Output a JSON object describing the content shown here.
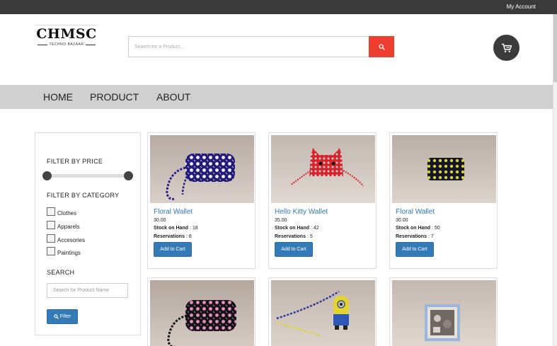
{
  "topbar": {
    "account_label": "My Account"
  },
  "header": {
    "logo_name": "CHMSC",
    "logo_tagline": "TECHNO BAZAAR",
    "search_placeholder": "Search for a Product...",
    "search_icon": "search-icon",
    "cart_icon": "cart-icon"
  },
  "nav": {
    "items": [
      "HOME",
      "PRODUCT",
      "ABOUT"
    ]
  },
  "filters": {
    "price_heading": "FILTER BY PRICE",
    "category_heading": "FILTER BY CATEGORY",
    "categories": [
      "Clothes",
      "Apparels",
      "Accesories",
      "Paintings"
    ],
    "search_heading": "SEARCH",
    "name_placeholder": "Search for Product Name",
    "filter_button": "Filter"
  },
  "products": [
    {
      "title": "Floral Wallet",
      "price": "30.00",
      "stock_label": "Stock on Hand",
      "stock": "18",
      "resv_label": "Reservations",
      "resv": "8",
      "button": "Add to Cart"
    },
    {
      "title": "Hello Kitty Wallet",
      "price": "35.00",
      "stock_label": "Stock on Hand",
      "stock": "42",
      "resv_label": "Reservations",
      "resv": "5",
      "button": "Add to Cart"
    },
    {
      "title": "Floral Wallet",
      "price": "30.00",
      "stock_label": "Stock on Hand",
      "stock": "50",
      "resv_label": "Reservations",
      "resv": "7",
      "button": "Add to Cart"
    },
    {
      "title": "",
      "price": "",
      "stock_label": "",
      "stock": "",
      "resv_label": "",
      "resv": "",
      "button": ""
    },
    {
      "title": "",
      "price": "",
      "stock_label": "",
      "stock": "",
      "resv_label": "",
      "resv": "",
      "button": ""
    },
    {
      "title": "",
      "price": "",
      "stock_label": "",
      "stock": "",
      "resv_label": "",
      "resv": "",
      "button": ""
    }
  ],
  "colors": {
    "accent": "#337ab7",
    "search_button": "#ee3e2f",
    "topbar": "#3a3a3a",
    "navbar": "#d0d0d0"
  }
}
